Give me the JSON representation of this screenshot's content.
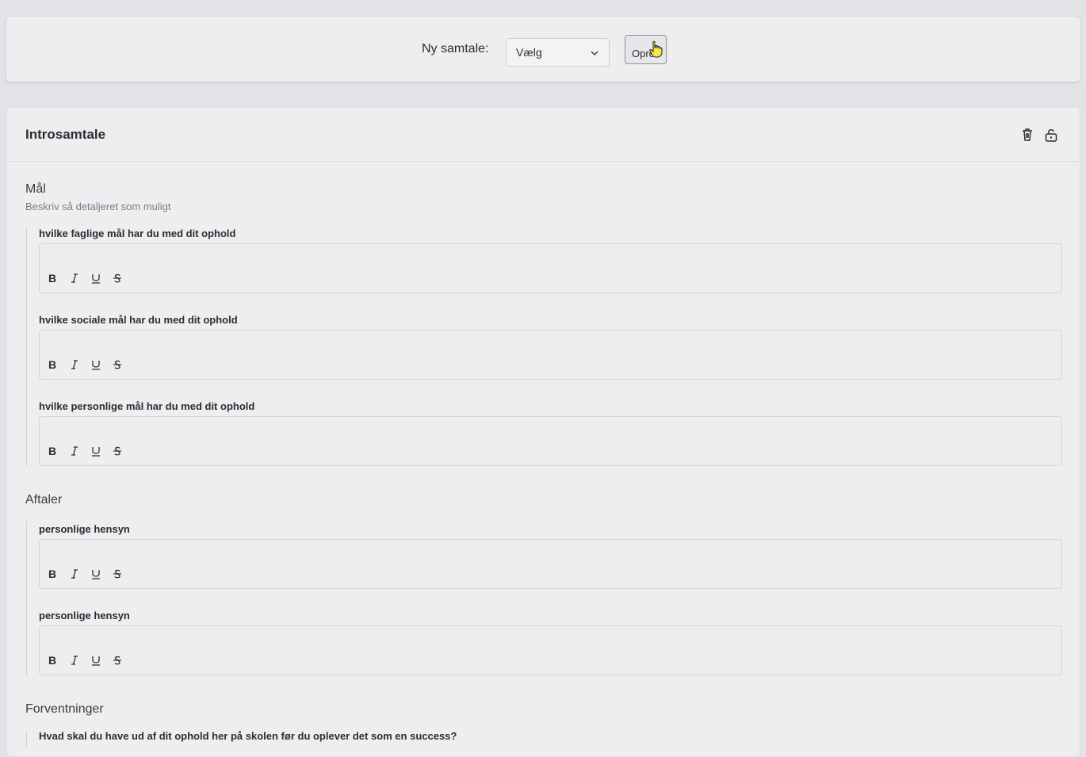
{
  "topbar": {
    "label": "Ny samtale:",
    "select_value": "Vælg",
    "create_button": "Opret"
  },
  "card": {
    "title": "Introsamtale",
    "sections": [
      {
        "title": "Mål",
        "subtitle": "Beskriv så detaljeret som muligt",
        "fields": [
          {
            "label": "hvilke faglige mål har du med dit ophold"
          },
          {
            "label": "hvilke sociale mål har du med dit ophold"
          },
          {
            "label": "hvilke personlige mål har du med dit ophold"
          }
        ]
      },
      {
        "title": "Aftaler",
        "fields": [
          {
            "label": "personlige hensyn"
          },
          {
            "label": "personlige hensyn"
          }
        ]
      },
      {
        "title": "Forventninger",
        "fields": [
          {
            "label": "Hvad skal du have ud af dit ophold her på skolen før du oplever det som en success?"
          }
        ]
      }
    ]
  },
  "icons": {
    "delete": "trash-icon",
    "lock": "unlock-icon",
    "bold": "bold-icon",
    "italic": "italic-icon",
    "underline": "underline-icon",
    "strike": "strikethrough-icon"
  }
}
